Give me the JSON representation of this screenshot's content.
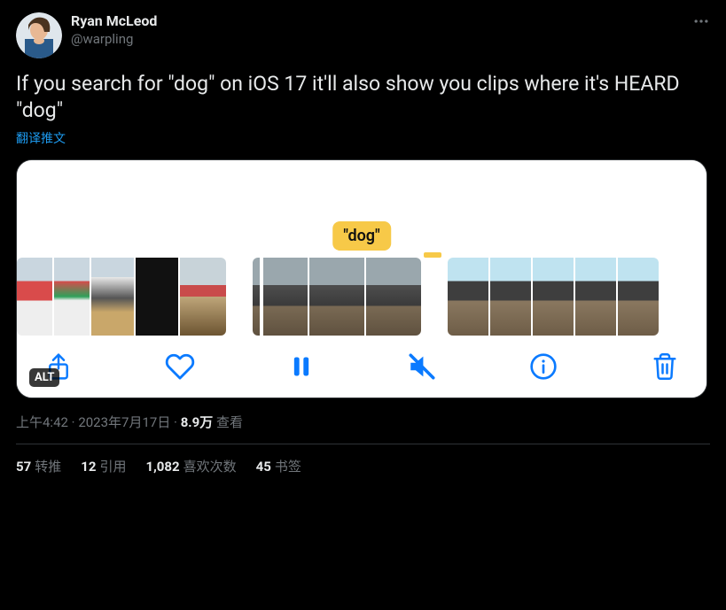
{
  "user": {
    "display_name": "Ryan McLeod",
    "handle": "@warpling"
  },
  "tweet_text": "If you search for \"dog\" on iOS 17 it'll also show you clips where it's HEARD \"dog\"",
  "translate_label": "翻译推文",
  "media": {
    "search_badge": "\"dog\"",
    "alt_badge": "ALT"
  },
  "meta": {
    "time": "上午4:42",
    "sep1": " · ",
    "date": "2023年7月17日",
    "sep2": " · ",
    "views_count": "8.9万",
    "views_label": " 查看"
  },
  "stats": {
    "retweets_count": "57",
    "retweets_label": "转推",
    "quotes_count": "12",
    "quotes_label": "引用",
    "likes_count": "1,082",
    "likes_label": "喜欢次数",
    "bookmarks_count": "45",
    "bookmarks_label": "书签"
  }
}
